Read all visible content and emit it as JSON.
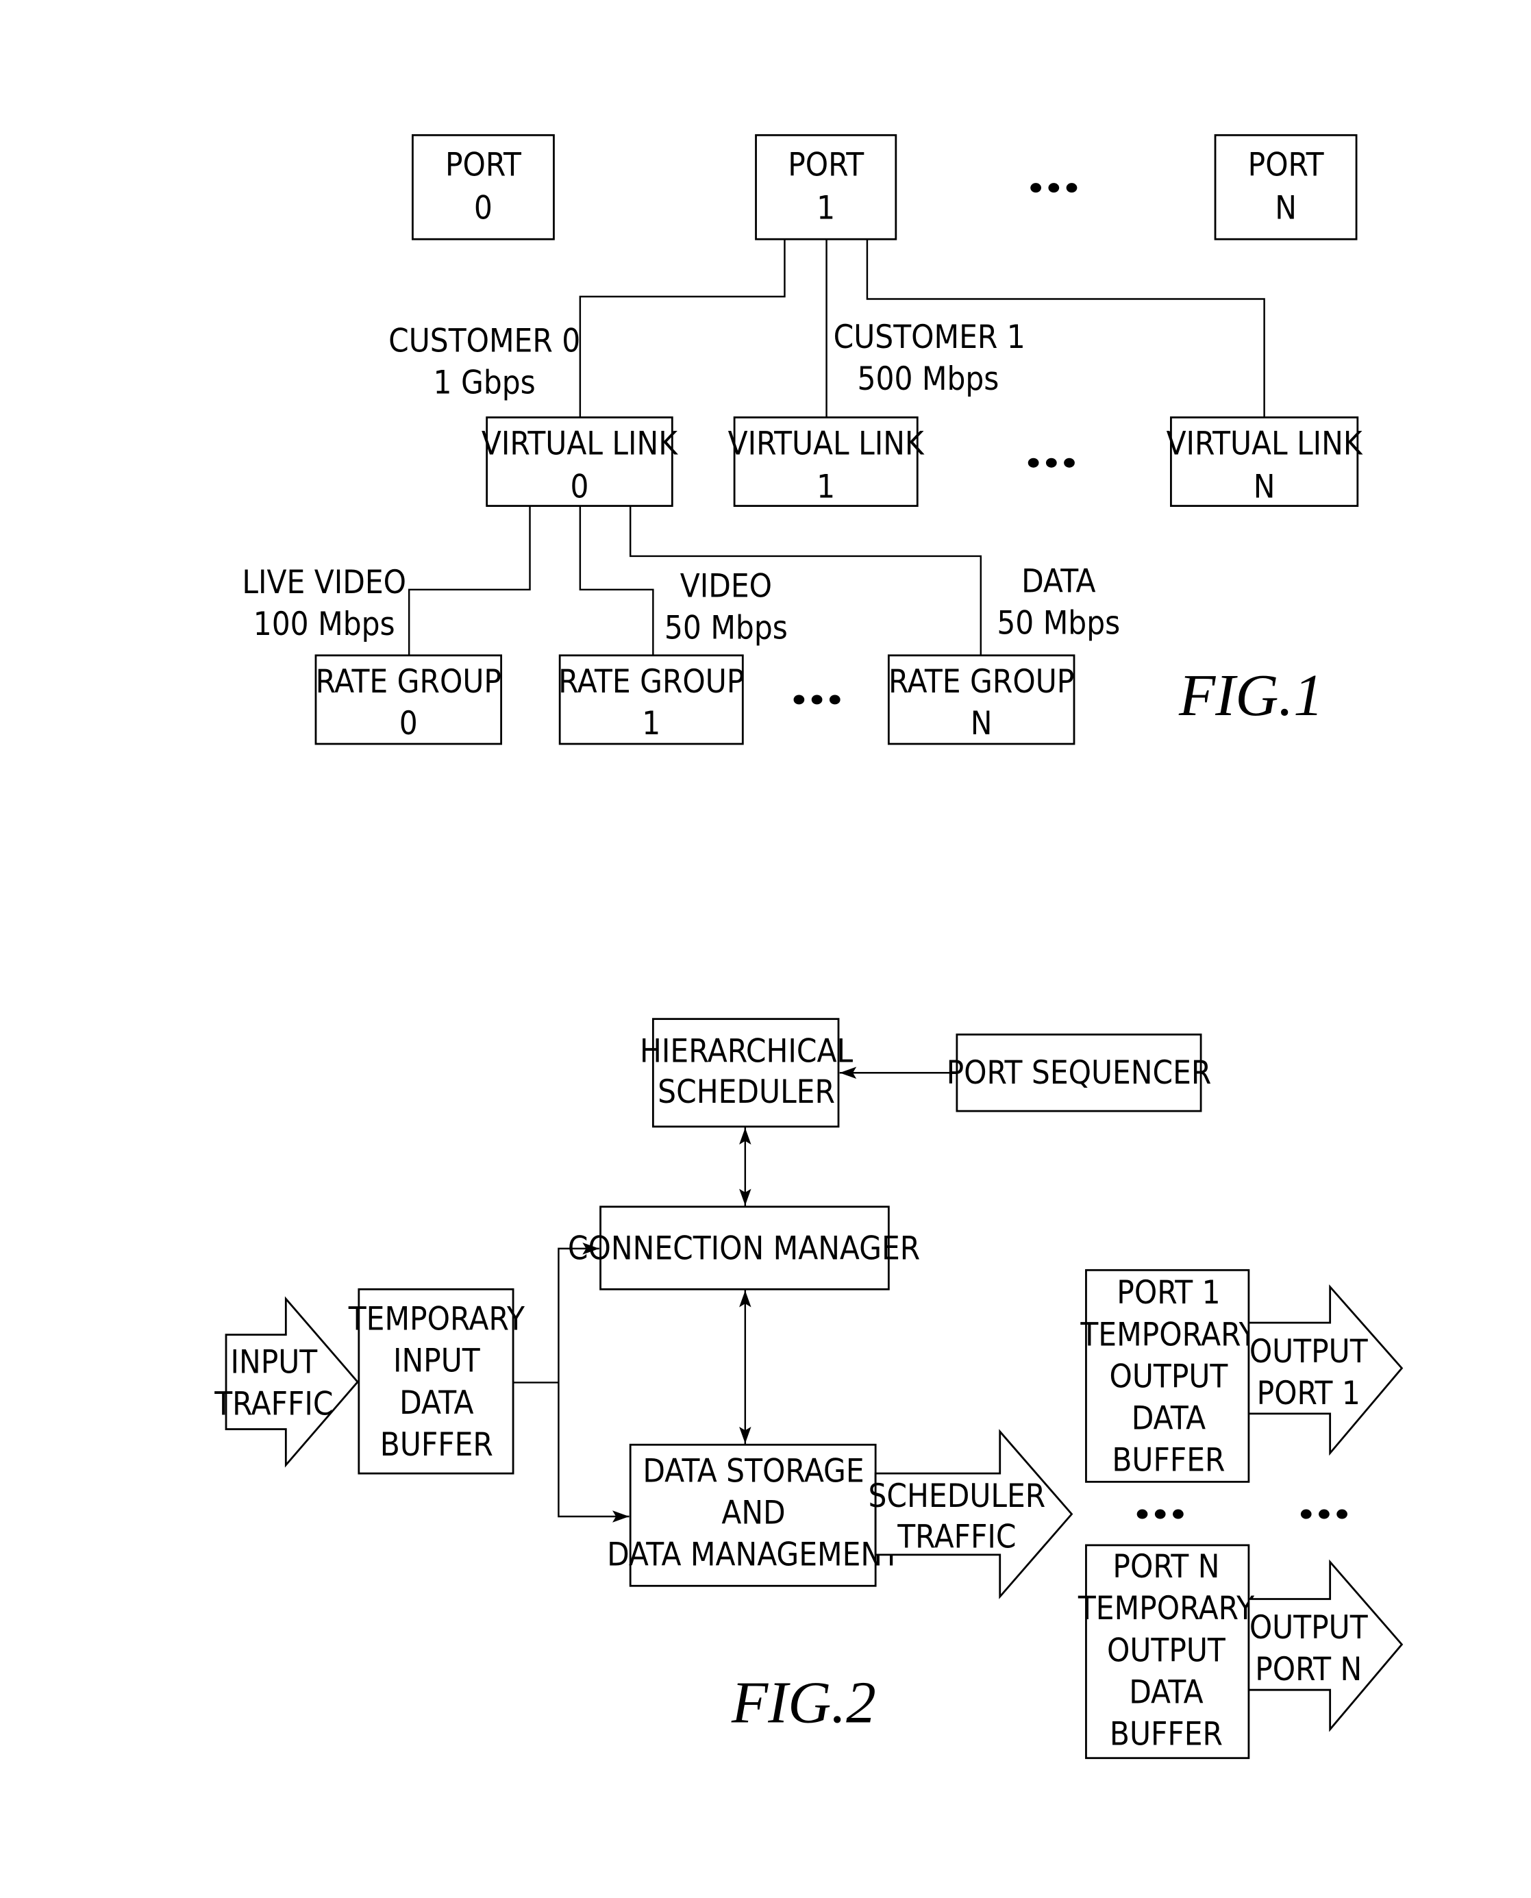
{
  "fig1": {
    "caption": "FIG.1",
    "ports": [
      {
        "line1": "PORT",
        "line2": "0"
      },
      {
        "line1": "PORT",
        "line2": "1"
      },
      {
        "line1": "PORT",
        "line2": "N"
      }
    ],
    "customers": [
      {
        "line1": "CUSTOMER 0",
        "line2": "1 Gbps"
      },
      {
        "line1": "CUSTOMER 1",
        "line2": "500 Mbps"
      }
    ],
    "virtual_links": [
      {
        "line1": "VIRTUAL LINK",
        "line2": "0"
      },
      {
        "line1": "VIRTUAL LINK",
        "line2": "1"
      },
      {
        "line1": "VIRTUAL LINK",
        "line2": "N"
      }
    ],
    "traffic_classes": [
      {
        "line1": "LIVE VIDEO",
        "line2": "100 Mbps"
      },
      {
        "line1": "VIDEO",
        "line2": "50 Mbps"
      },
      {
        "line1": "DATA",
        "line2": "50 Mbps"
      }
    ],
    "rate_groups": [
      {
        "line1": "RATE GROUP",
        "line2": "0"
      },
      {
        "line1": "RATE GROUP",
        "line2": "1"
      },
      {
        "line1": "RATE GROUP",
        "line2": "N"
      }
    ],
    "ellipsis": "•••"
  },
  "fig2": {
    "caption": "FIG.2",
    "hierarchical_scheduler": [
      "HIERARCHICAL",
      "SCHEDULER"
    ],
    "port_sequencer": [
      "PORT SEQUENCER"
    ],
    "connection_manager": [
      "CONNECTION MANAGER"
    ],
    "input_traffic": [
      "INPUT",
      "TRAFFIC"
    ],
    "temp_input_buffer": [
      "TEMPORARY",
      "INPUT",
      "DATA",
      "BUFFER"
    ],
    "data_storage": [
      "DATA STORAGE",
      "AND",
      "DATA MANAGEMENT"
    ],
    "scheduler_traffic": [
      "SCHEDULER",
      "TRAFFIC"
    ],
    "port1_output_buffer": [
      "PORT 1",
      "TEMPORARY",
      "OUTPUT",
      "DATA",
      "BUFFER"
    ],
    "portN_output_buffer": [
      "PORT N",
      "TEMPORARY",
      "OUTPUT",
      "DATA",
      "BUFFER"
    ],
    "output_port1": [
      "OUTPUT",
      "PORT 1"
    ],
    "output_portN": [
      "OUTPUT",
      "PORT N"
    ],
    "ellipsis": "•••"
  }
}
